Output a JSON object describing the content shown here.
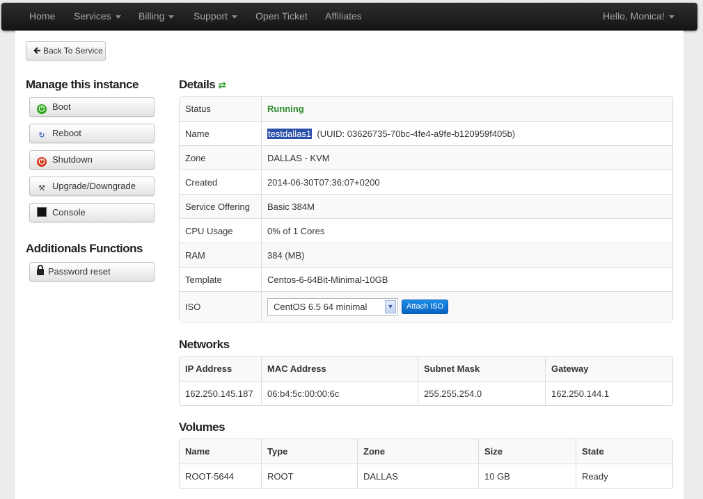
{
  "navbar": {
    "items": [
      {
        "label": "Home",
        "dropdown": false
      },
      {
        "label": "Services",
        "dropdown": true
      },
      {
        "label": "Billing",
        "dropdown": true
      },
      {
        "label": "Support",
        "dropdown": true
      },
      {
        "label": "Open Ticket",
        "dropdown": false
      },
      {
        "label": "Affiliates",
        "dropdown": false
      }
    ],
    "user": "Hello, Monica!"
  },
  "back_button": {
    "label": "Back To Service",
    "icon": "arrow-left-icon"
  },
  "sidebar": {
    "manage_heading": "Manage this instance",
    "manage_buttons": [
      {
        "label": "Boot",
        "icon": "power-on-icon",
        "color": "#2ca51a"
      },
      {
        "label": "Reboot",
        "icon": "reboot-icon",
        "color": "#4a6fc4"
      },
      {
        "label": "Shutdown",
        "icon": "power-off-icon",
        "color": "#d6381c"
      },
      {
        "label": "Upgrade/Downgrade",
        "icon": "tools-icon"
      },
      {
        "label": "Console",
        "icon": "console-icon"
      }
    ],
    "additional_heading": "Additionals Functions",
    "additional_buttons": [
      {
        "label": "Password reset",
        "icon": "lock-icon"
      }
    ]
  },
  "details": {
    "title": "Details",
    "rows": {
      "status": {
        "label": "Status",
        "value": "Running",
        "color": "#2a8a2a"
      },
      "name": {
        "label": "Name",
        "value": "testdallas1",
        "uuid": "(UUID: 03626735-70bc-4fe4-a9fe-b120959f405b)"
      },
      "zone": {
        "label": "Zone",
        "value": "DALLAS - KVM"
      },
      "created": {
        "label": "Created",
        "value": "2014-06-30T07:36:07+0200"
      },
      "service_offering": {
        "label": "Service Offering",
        "value": "Basic 384M"
      },
      "cpu_usage": {
        "label": "CPU Usage",
        "value": "0% of 1 Cores"
      },
      "ram": {
        "label": "RAM",
        "value": "384 (MB)"
      },
      "template": {
        "label": "Template",
        "value": "Centos-6-64Bit-Minimal-10GB"
      },
      "iso": {
        "label": "ISO",
        "selected": "CentOS 6.5 64 minimal",
        "attach_label": "Attach ISO"
      }
    }
  },
  "networks": {
    "title": "Networks",
    "headers": [
      "IP Address",
      "MAC Address",
      "Subnet Mask",
      "Gateway"
    ],
    "rows": [
      [
        "162.250.145.187",
        "06:b4:5c:00:00:6c",
        "255.255.254.0",
        "162.250.144.1"
      ]
    ]
  },
  "volumes": {
    "title": "Volumes",
    "headers": [
      "Name",
      "Type",
      "Zone",
      "Size",
      "State"
    ],
    "rows": [
      [
        "ROOT-5644",
        "ROOT",
        "DALLAS",
        "10 GB",
        "Ready"
      ]
    ]
  }
}
